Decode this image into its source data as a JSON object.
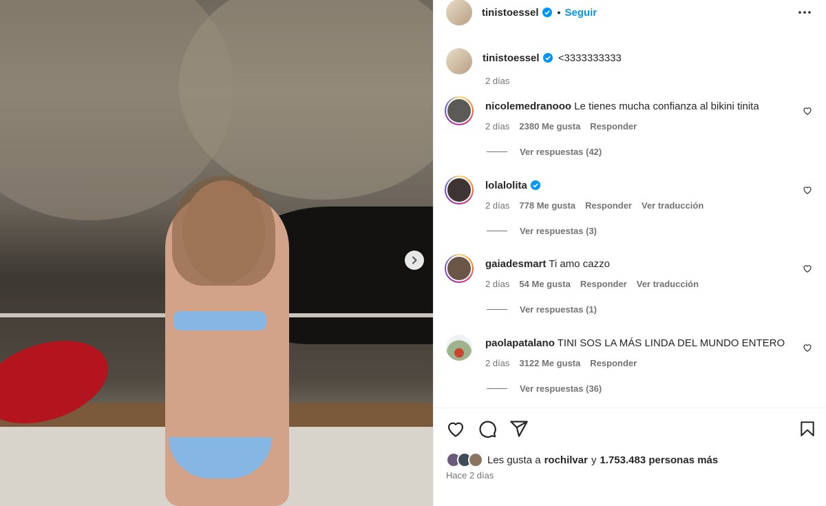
{
  "post": {
    "author": "tinistoessel",
    "follow_label": "Seguir",
    "dot": "•",
    "caption_text": "<3333333333",
    "caption_time": "2 días"
  },
  "comments": [
    {
      "user": "nicolemedranooo",
      "text": "Le tienes mucha confianza al bikini tinita",
      "time": "2 días",
      "likes": "2380 Me gusta",
      "reply": "Responder",
      "translate": "",
      "replies": "Ver respuestas (42)",
      "verified": false
    },
    {
      "user": "lolalolita",
      "text": "",
      "time": "2 días",
      "likes": "778 Me gusta",
      "reply": "Responder",
      "translate": "Ver traducción",
      "replies": "Ver respuestas (3)",
      "verified": true
    },
    {
      "user": "gaiadesmart",
      "text": "Ti amo cazzo",
      "time": "2 días",
      "likes": "54 Me gusta",
      "reply": "Responder",
      "translate": "Ver traducción",
      "replies": "Ver respuestas (1)",
      "verified": false
    },
    {
      "user": "paolapatalano",
      "text": "TINI SOS LA MÁS LINDA DEL MUNDO ENTERO",
      "time": "2 días",
      "likes": "3122 Me gusta",
      "reply": "Responder",
      "translate": "",
      "replies": "Ver respuestas (36)",
      "verified": false
    }
  ],
  "likes_bar": {
    "prefix": "Les gusta a",
    "user": "rochilvar",
    "conj": "y",
    "count": "1.753.483 personas más",
    "time": "Hace 2 días"
  },
  "colors": {
    "accent": "#0095f6",
    "verified": "#0095f6",
    "muted": "#737373"
  }
}
